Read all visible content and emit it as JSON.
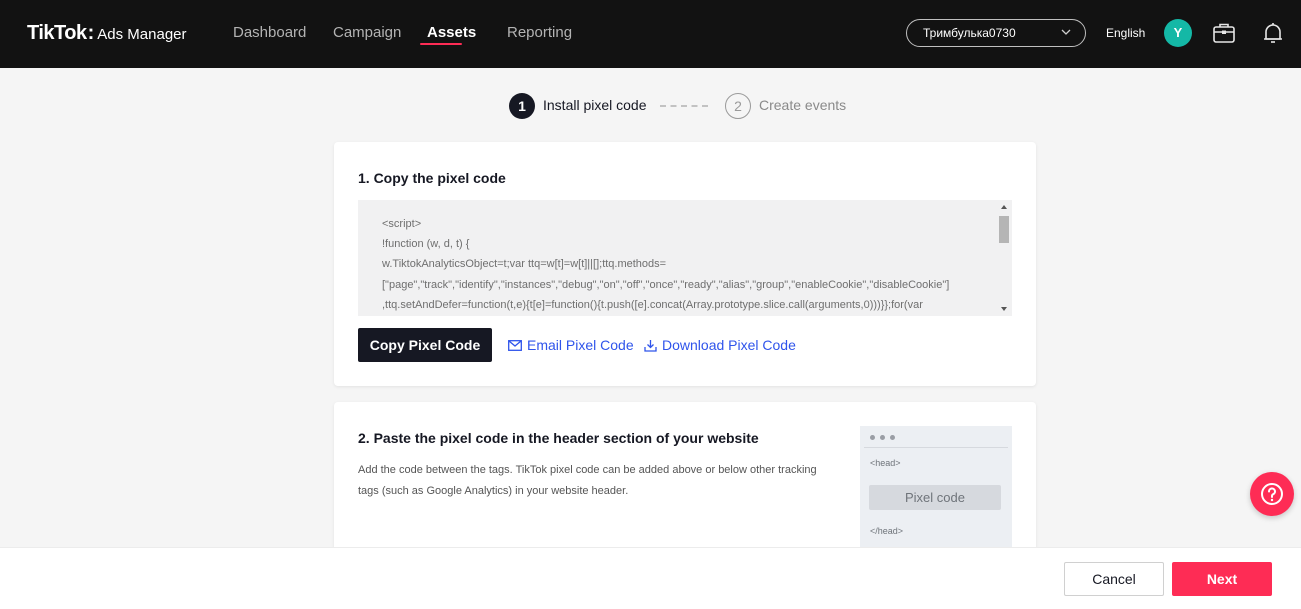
{
  "header": {
    "logo_main": "TikTok",
    "logo_colon": ":",
    "logo_sub": "Ads Manager",
    "nav": [
      {
        "label": "Dashboard"
      },
      {
        "label": "Campaign"
      },
      {
        "label": "Assets",
        "active": true
      },
      {
        "label": "Reporting"
      }
    ],
    "account_name": "Тримбулька0730",
    "language": "English",
    "avatar_initial": "Y",
    "icons": [
      "chevron-down-icon",
      "briefcase-icon",
      "bell-icon"
    ]
  },
  "stepper": {
    "steps": [
      {
        "number": "1",
        "label": "Install pixel code",
        "active": true
      },
      {
        "number": "2",
        "label": "Create events",
        "active": false
      }
    ]
  },
  "card1": {
    "title": "1. Copy the pixel code",
    "code_lines": [
      "<script>",
      "!function (w, d, t) {",
      "  w.TiktokAnalyticsObject=t;var ttq=w[t]=w[t]||[];ttq.methods=",
      "[\"page\",\"track\",\"identify\",\"instances\",\"debug\",\"on\",\"off\",\"once\",\"ready\",\"alias\",\"group\",\"enableCookie\",\"disableCookie\"]",
      ",ttq.setAndDefer=function(t,e){t[e]=function(){t.push([e].concat(Array.prototype.slice.call(arguments,0)))}};for(var"
    ],
    "copy_button": "Copy Pixel Code",
    "email_link": "Email Pixel Code",
    "download_link": "Download Pixel Code"
  },
  "card2": {
    "title": "2. Paste the pixel code in the header section of your website",
    "description": "Add the code between the tags. TikTok pixel code can be added above or below other tracking tags (such as Google Analytics) in your website header.",
    "mock_head_open": "<head>",
    "mock_pixel_label": "Pixel code",
    "mock_head_close": "</head>"
  },
  "footer": {
    "cancel_label": "Cancel",
    "next_label": "Next"
  },
  "colors": {
    "brand_accent": "#fe2c55",
    "topbar_bg": "#121212",
    "link_blue": "#2f54eb",
    "avatar_teal": "#14b8a6"
  }
}
